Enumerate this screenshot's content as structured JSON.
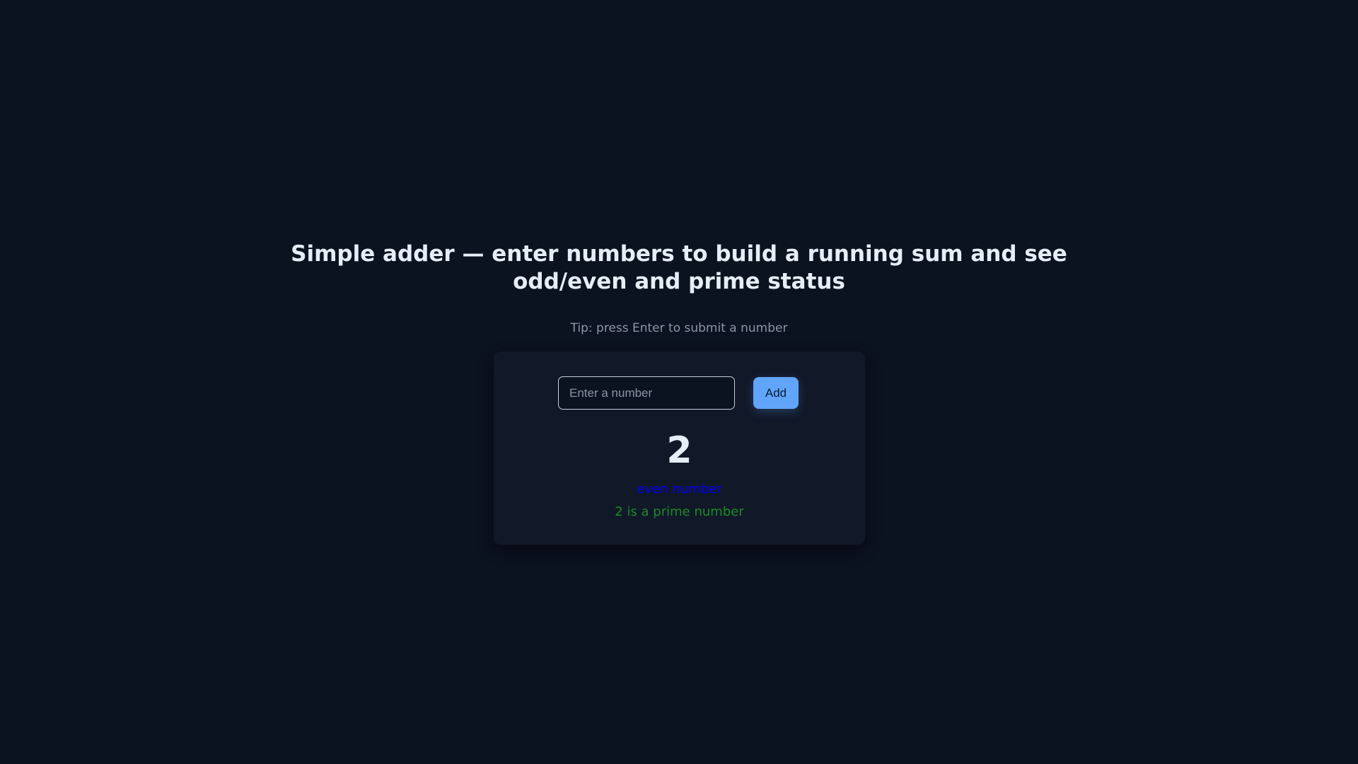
{
  "header": {
    "title_line1": "Simple adder — enter numbers to build a running sum and see",
    "title_line2": "odd/even and prime status",
    "tip": "Tip: press Enter to submit a number"
  },
  "form": {
    "input_placeholder": "Enter a number",
    "input_value": "",
    "add_label": "Add"
  },
  "result": {
    "sum": "2",
    "parity": "even number",
    "prime_status": "2 is a prime number"
  },
  "colors": {
    "background": "#0b1220",
    "card": "#111827",
    "accent": "#60a5fa",
    "parity_text": "#0000ff",
    "prime_text": "#1a8c2a"
  }
}
